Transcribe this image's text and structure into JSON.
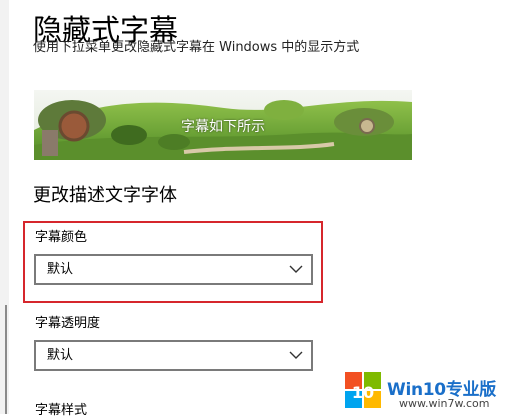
{
  "page": {
    "title": "隐藏式字幕",
    "description": "使用下拉菜单更改隐藏式字幕在 Windows 中的显示方式"
  },
  "preview": {
    "caption": "字幕如下所示"
  },
  "section": {
    "title": "更改描述文字字体"
  },
  "fields": {
    "caption_color": {
      "label": "字幕颜色",
      "value": "默认"
    },
    "caption_transparency": {
      "label": "字幕透明度",
      "value": "默认"
    },
    "caption_style": {
      "label": "字幕样式"
    }
  },
  "watermark": {
    "logo_digits": "10",
    "brand": "Win10专业版",
    "site": "www.win7w.com"
  },
  "colors": {
    "highlight_border": "#d6262c",
    "select_border": "#7a7a7a",
    "brand_blue": "#1a6fc9"
  },
  "icons": {
    "dropdown": "chevron-down-icon"
  }
}
